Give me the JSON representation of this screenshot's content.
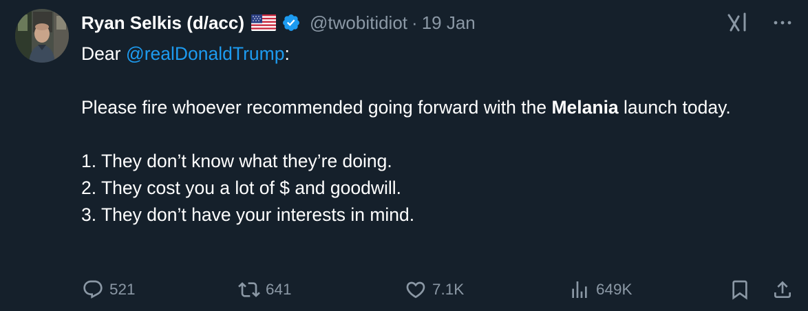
{
  "author": {
    "display_name": "Ryan Selkis (d/acc)",
    "handle": "@twobitidiot",
    "separator": "·",
    "date": "19 Jan",
    "flag_icon": "us-flag-icon",
    "verified_icon": "verified-badge-icon",
    "verified_color": "#1d9bf0"
  },
  "tweet": {
    "greeting_prefix": "Dear ",
    "mention": "@realDonaldTrump",
    "greeting_suffix": ":",
    "line1_prefix": "Please fire whoever recommended going forward with the ",
    "line1_bold": "Melania",
    "line1_suffix": " launch today.",
    "list": [
      "1. They don’t know what they’re doing.",
      "2. They cost you a lot of $ and goodwill.",
      "3. They don’t have your interests in mind."
    ]
  },
  "actions": {
    "replies": "521",
    "reposts": "641",
    "likes": "7.1K",
    "views": "649K"
  },
  "colors": {
    "background": "#15202b",
    "text": "#ffffff",
    "secondary": "#8b98a5",
    "link": "#1d9bf0"
  }
}
